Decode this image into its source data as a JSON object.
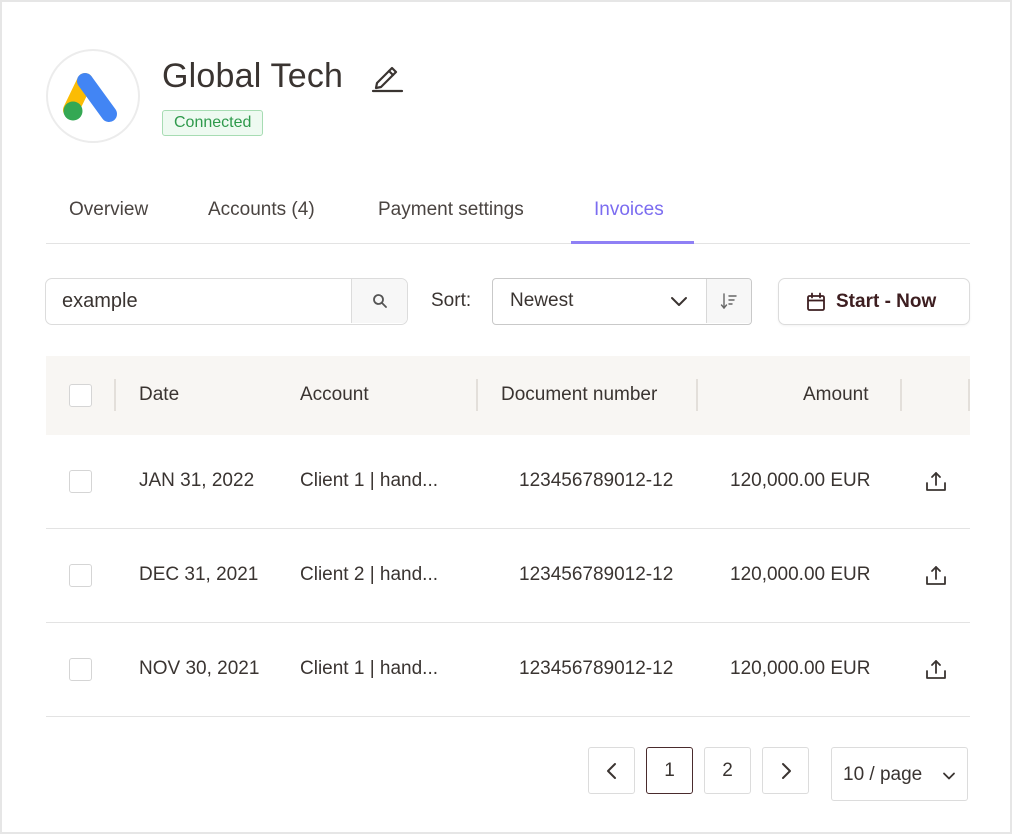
{
  "header": {
    "title": "Global Tech",
    "status": "Connected",
    "logo_icon": "google-ads-logo-icon",
    "status_color": "#2f9a4c",
    "accent_color": "#7b6cf0"
  },
  "tabs": [
    {
      "label": "Overview",
      "active": false
    },
    {
      "label": "Accounts (4)",
      "active": false
    },
    {
      "label": "Payment settings",
      "active": false
    },
    {
      "label": "Invoices",
      "active": true
    }
  ],
  "toolbar": {
    "search_value": "example",
    "sort_label": "Sort:",
    "sort_value": "Newest",
    "date_range_label": "Start - Now"
  },
  "table": {
    "columns": [
      "Date",
      "Account",
      "Document number",
      "Amount"
    ],
    "rows": [
      {
        "date": "JAN 31, 2022",
        "account": "Client 1 | hand...",
        "document": "123456789012-12",
        "amount": "120,000.00 EUR"
      },
      {
        "date": "DEC 31, 2021",
        "account": "Client 2 | hand...",
        "document": "123456789012-12",
        "amount": "120,000.00 EUR"
      },
      {
        "date": "NOV 30, 2021",
        "account": "Client 1 | hand...",
        "document": "123456789012-12",
        "amount": "120,000.00 EUR"
      }
    ]
  },
  "pagination": {
    "pages": [
      "1",
      "2"
    ],
    "current_page": "1",
    "page_size": "10 / page"
  }
}
